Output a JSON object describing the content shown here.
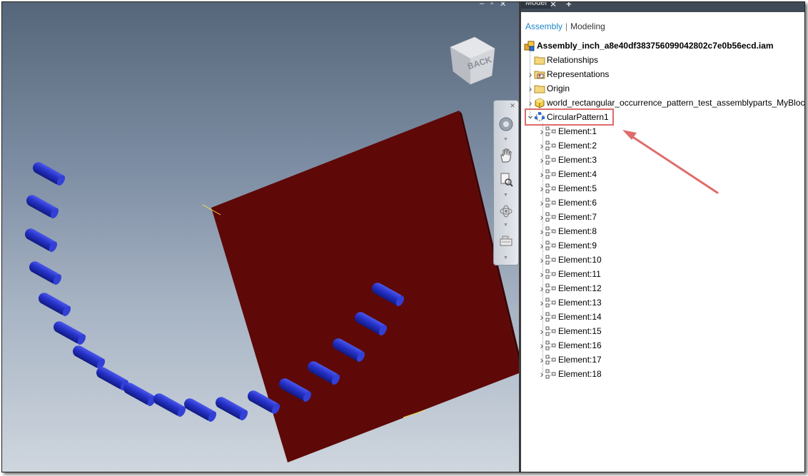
{
  "window_controls": {
    "minimize": "–",
    "restore": "▫",
    "close": "✕"
  },
  "panel": {
    "tab_label": "Model",
    "tab_close": "✕",
    "tab_add": "+",
    "subtabs": {
      "assembly": "Assembly",
      "separator": "|",
      "modeling": "Modeling"
    },
    "root": {
      "label": "Assembly_inch_a8e40df383756099042802c7e0b56ecd.iam",
      "icon": "assembly-icon"
    },
    "top_items": [
      {
        "label": "Relationships",
        "icon": "folder-icon",
        "expandable": false
      },
      {
        "label": "Representations",
        "icon": "representations-icon",
        "expandable": true
      },
      {
        "label": "Origin",
        "icon": "folder-icon",
        "expandable": true
      },
      {
        "label": "world_rectangular_occurrence_pattern_test_assemblyparts_MyBlock",
        "icon": "part-icon",
        "expandable": true
      },
      {
        "label": "CircularPattern1",
        "icon": "circular-pattern-icon",
        "expandable": true,
        "expanded": true,
        "highlighted": true
      }
    ],
    "elements": [
      "Element:1",
      "Element:2",
      "Element:3",
      "Element:4",
      "Element:5",
      "Element:6",
      "Element:7",
      "Element:8",
      "Element:9",
      "Element:10",
      "Element:11",
      "Element:12",
      "Element:13",
      "Element:14",
      "Element:15",
      "Element:16",
      "Element:17",
      "Element:18"
    ]
  },
  "viewcube": {
    "face_label": "BACK"
  },
  "colors": {
    "block": "#5e0808",
    "cylinders": "#2632c8",
    "highlight_box": "#e06b6b",
    "annotation_arrow": "#e06b6b",
    "assembly_tab_active": "#1b87c9"
  }
}
